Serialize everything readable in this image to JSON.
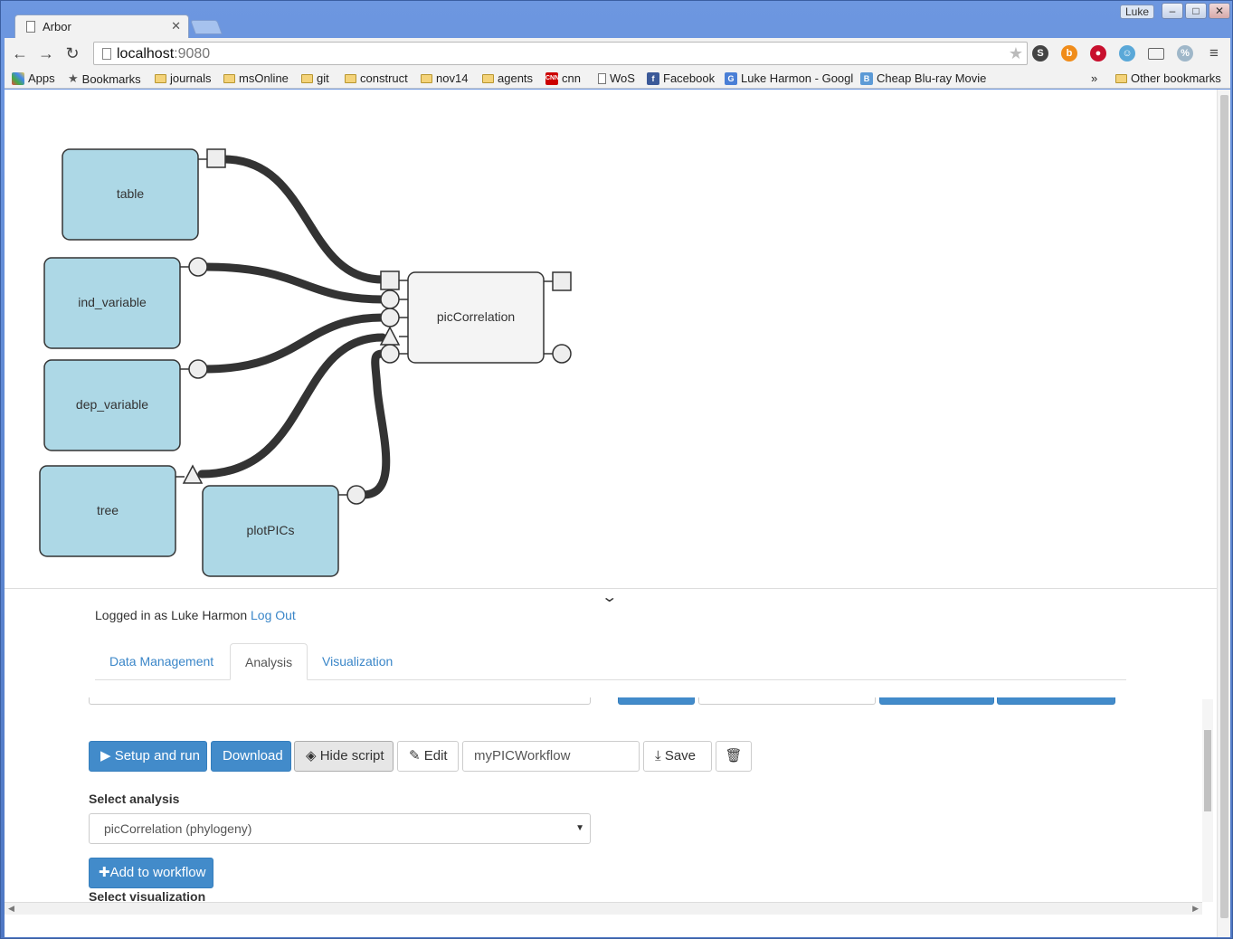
{
  "window": {
    "tab_title": "Arbor",
    "profile_name": "Luke",
    "minimize": "–",
    "maximize": "□",
    "close": "✕"
  },
  "toolbar": {
    "url_host": "localhost",
    "url_port": ":9080"
  },
  "bookmarks": [
    {
      "label": "Apps",
      "icon": "apps-grid-icon"
    },
    {
      "label": "Bookmarks",
      "icon": "star-icon"
    },
    {
      "label": "journals",
      "icon": "folder-icon"
    },
    {
      "label": "msOnline",
      "icon": "folder-icon"
    },
    {
      "label": "git",
      "icon": "folder-icon"
    },
    {
      "label": "construct",
      "icon": "folder-icon"
    },
    {
      "label": "nov14",
      "icon": "folder-icon"
    },
    {
      "label": "agents",
      "icon": "folder-icon"
    },
    {
      "label": "cnn",
      "icon": "cnn-icon"
    },
    {
      "label": "WoS",
      "icon": "page-icon"
    },
    {
      "label": "Facebook",
      "icon": "facebook-icon"
    },
    {
      "label": "Luke Harmon - Googl",
      "icon": "scholar-icon"
    },
    {
      "label": "Cheap Blu-ray Movie",
      "icon": "bluray-icon"
    }
  ],
  "bookmarks_overflow": "»",
  "other_bookmarks": "Other bookmarks",
  "workflow": {
    "nodes": {
      "table": "table",
      "ind_variable": "ind_variable",
      "dep_variable": "dep_variable",
      "tree": "tree",
      "plotPICs": "plotPICs",
      "picCorrelation": "picCorrelation"
    },
    "colors": {
      "input_node": "#add8e6",
      "analysis_node": "#f4f4f4",
      "connection": "#333333"
    }
  },
  "session": {
    "logged_in_text": "Logged in as Luke Harmon",
    "logout_label": "Log Out"
  },
  "tabs": [
    {
      "label": "Data Management",
      "active": false
    },
    {
      "label": "Analysis",
      "active": true
    },
    {
      "label": "Visualization",
      "active": false
    }
  ],
  "analysis_panel": {
    "setup_run_label": "▶ Setup and run",
    "download_label": "Download",
    "hide_script_label": "Hide script",
    "edit_label": "Edit",
    "workflow_name": "myPICWorkflow",
    "save_label": "Save",
    "select_analysis_label": "Select analysis",
    "selected_analysis": "picCorrelation (phylogeny)",
    "add_to_workflow_label": "Add to workflow",
    "select_visualization_label": "Select visualization"
  }
}
